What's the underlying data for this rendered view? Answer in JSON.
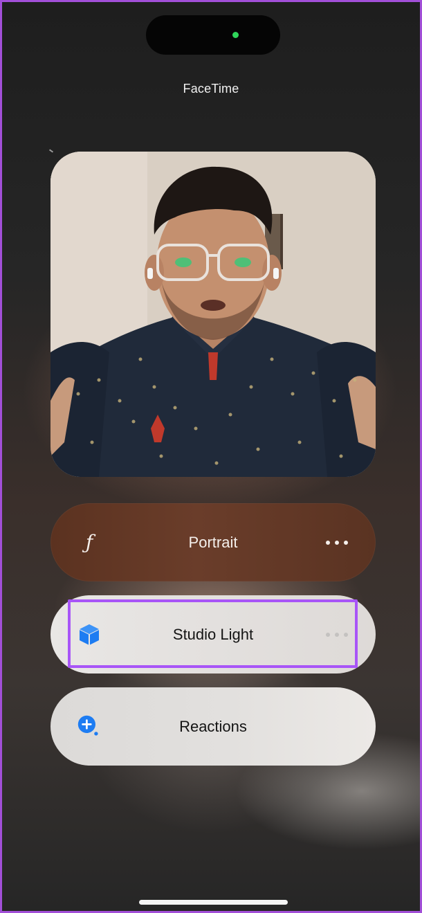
{
  "app": {
    "title": "FaceTime"
  },
  "status": {
    "camera_indicator_color": "#2fd65a"
  },
  "video_tiles": {
    "self_view": {
      "subject": "selfie-camera-preview"
    }
  },
  "controls": {
    "portrait": {
      "label": "Portrait",
      "icon": "f-aperture-icon",
      "more_icon": "ellipsis-icon"
    },
    "studio_light": {
      "label": "Studio Light",
      "icon": "cube-icon",
      "more_icon": "ellipsis-icon",
      "highlighted": true
    },
    "reactions": {
      "label": "Reactions",
      "icon": "reactions-plus-icon"
    }
  },
  "colors": {
    "highlight": "#a855f7",
    "icon_blue": "#1d7cf2",
    "portrait_pill": "#6a3d2a"
  }
}
